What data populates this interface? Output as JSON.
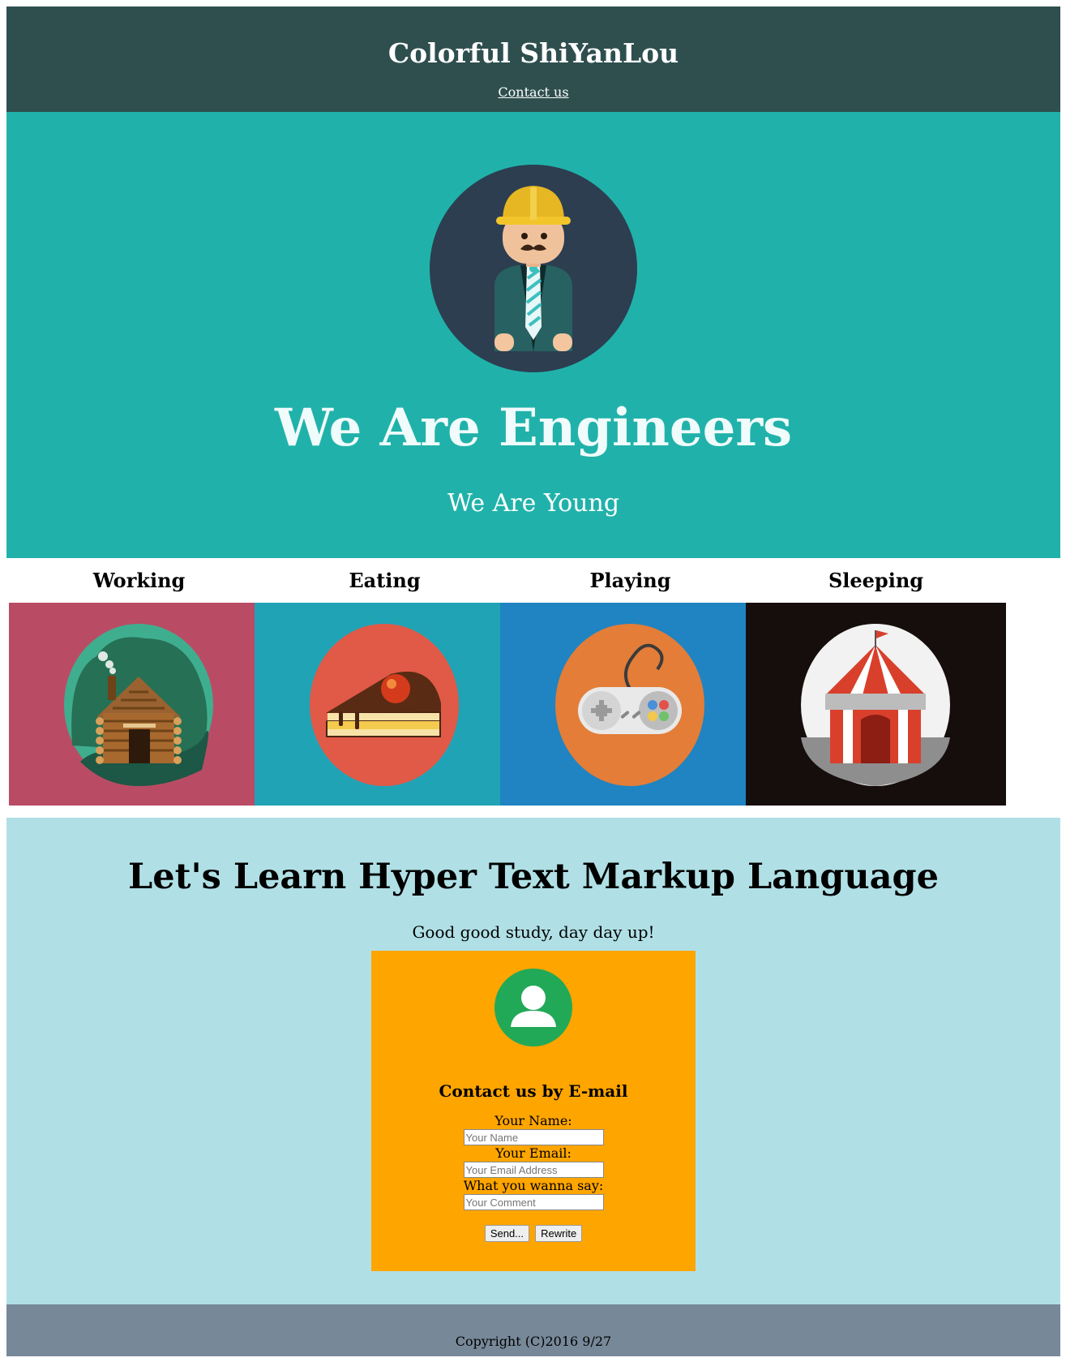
{
  "header": {
    "title": "Colorful ShiYanLou",
    "contact_link": "Contact us"
  },
  "hero": {
    "title": "We Are Engineers",
    "subtitle": "We Are Young"
  },
  "activities": [
    {
      "label": "Working",
      "color": "#b94c64"
    },
    {
      "label": "Eating",
      "color": "#21a3b6"
    },
    {
      "label": "Playing",
      "color": "#1f84c1"
    },
    {
      "label": "Sleeping",
      "color": "#150e0c"
    }
  ],
  "learn": {
    "title": "Let's Learn Hyper Text Markup Language",
    "subtitle": "Good good study, day day up!",
    "form": {
      "heading": "Contact us by E-mail",
      "name_label": "Your Name:",
      "name_placeholder": "Your Name",
      "email_label": "Your Email:",
      "email_placeholder": "Your Email Address",
      "comment_label": "What you wanna say:",
      "comment_placeholder": "Your Comment",
      "send_label": "Send...",
      "rewrite_label": "Rewrite"
    }
  },
  "footer": {
    "copyright": "Copyright (C)2016 9/27"
  },
  "colors": {
    "header_bg": "#2f4f4f",
    "hero_bg": "#20b2aa",
    "learn_bg": "#b0e0e6",
    "card_bg": "#ffa500",
    "footer_bg": "#778899"
  }
}
